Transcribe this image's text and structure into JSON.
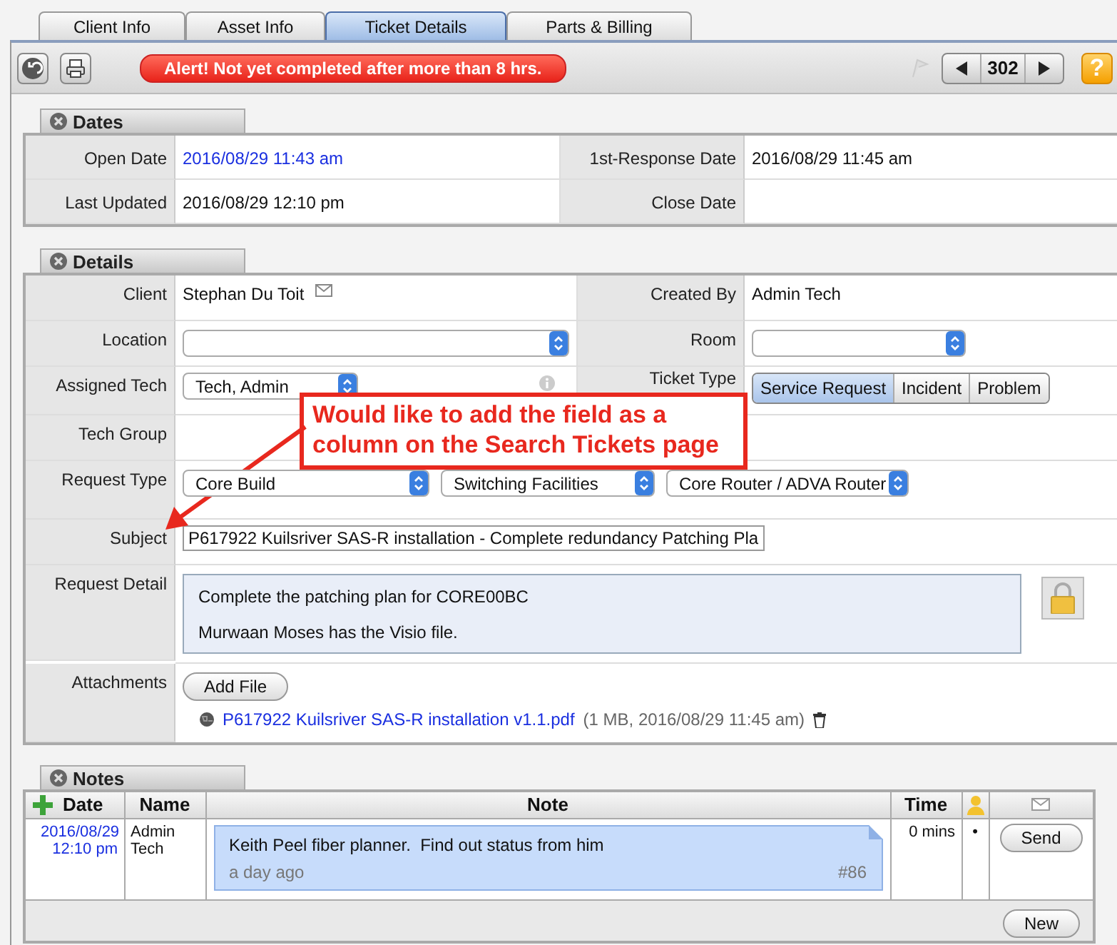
{
  "tabs": [
    {
      "label": "Client Info",
      "selected": false
    },
    {
      "label": "Asset Info",
      "selected": false
    },
    {
      "label": "Ticket Details",
      "selected": true
    },
    {
      "label": "Parts & Billing",
      "selected": false
    }
  ],
  "toolbar": {
    "alert": "Alert! Not yet completed after more than 8 hrs.",
    "ticket_number": "302",
    "help": "?"
  },
  "dates": {
    "title": "Dates",
    "fields": [
      {
        "label": "Open Date",
        "value": "2016/08/29 11:43 am",
        "kind": "link"
      },
      {
        "label": "1st-Response Date",
        "value": "2016/08/29 11:45 am",
        "kind": "text"
      },
      {
        "label": "Last Updated",
        "value": "2016/08/29 12:10 pm",
        "kind": "text"
      },
      {
        "label": "Close Date"
      }
    ]
  },
  "details": {
    "title": "Details",
    "client": {
      "label": "Client",
      "value": "Stephan Du Toit"
    },
    "created_by": {
      "label": "Created By",
      "value": "Admin Tech"
    },
    "location": {
      "label": "Location"
    },
    "room": {
      "label": "Room"
    },
    "assigned_tech": {
      "label": "Assigned Tech",
      "value": "Tech, Admin"
    },
    "ticket_type": {
      "label": "Ticket Type",
      "options": [
        {
          "label": "Service Request",
          "selected": true
        },
        {
          "label": "Incident",
          "selected": false
        },
        {
          "label": "Problem",
          "selected": false
        }
      ]
    },
    "tech_group": {
      "label": "Tech Group"
    },
    "request_type": {
      "label": "Request Type",
      "selects": [
        "Core Build",
        "Switching Facilities",
        "Core Router / ADVA Router"
      ]
    },
    "subject": {
      "label": "Subject",
      "value": "P617922 Kuilsriver SAS-R installation - Complete redundancy Patching Pla"
    },
    "request_detail": {
      "label": "Request Detail",
      "lines": [
        "Complete the patching plan for CORE00BC",
        "Murwaan Moses has the Visio file."
      ]
    },
    "attachments": {
      "label": "Attachments",
      "button": "Add File",
      "files": [
        {
          "name": "P617922 Kuilsriver SAS-R installation v1.1.pdf",
          "info": "(1 MB, 2016/08/29 11:45 am)"
        }
      ]
    }
  },
  "notes": {
    "title": "Notes",
    "columns": [
      "Date",
      "Name",
      "Note",
      "Time"
    ],
    "rows": [
      {
        "date": "2016/08/29 12:10 pm",
        "name": "Admin Tech",
        "note": "Keith Peel fiber planner.  Find out status from him",
        "age": "a day ago",
        "number": "#86",
        "time": "0 mins",
        "private": "•",
        "send": "Send"
      }
    ],
    "new_button": "New"
  },
  "annotation": {
    "text": "Would like to add the field as a column on the Search Tickets page"
  }
}
